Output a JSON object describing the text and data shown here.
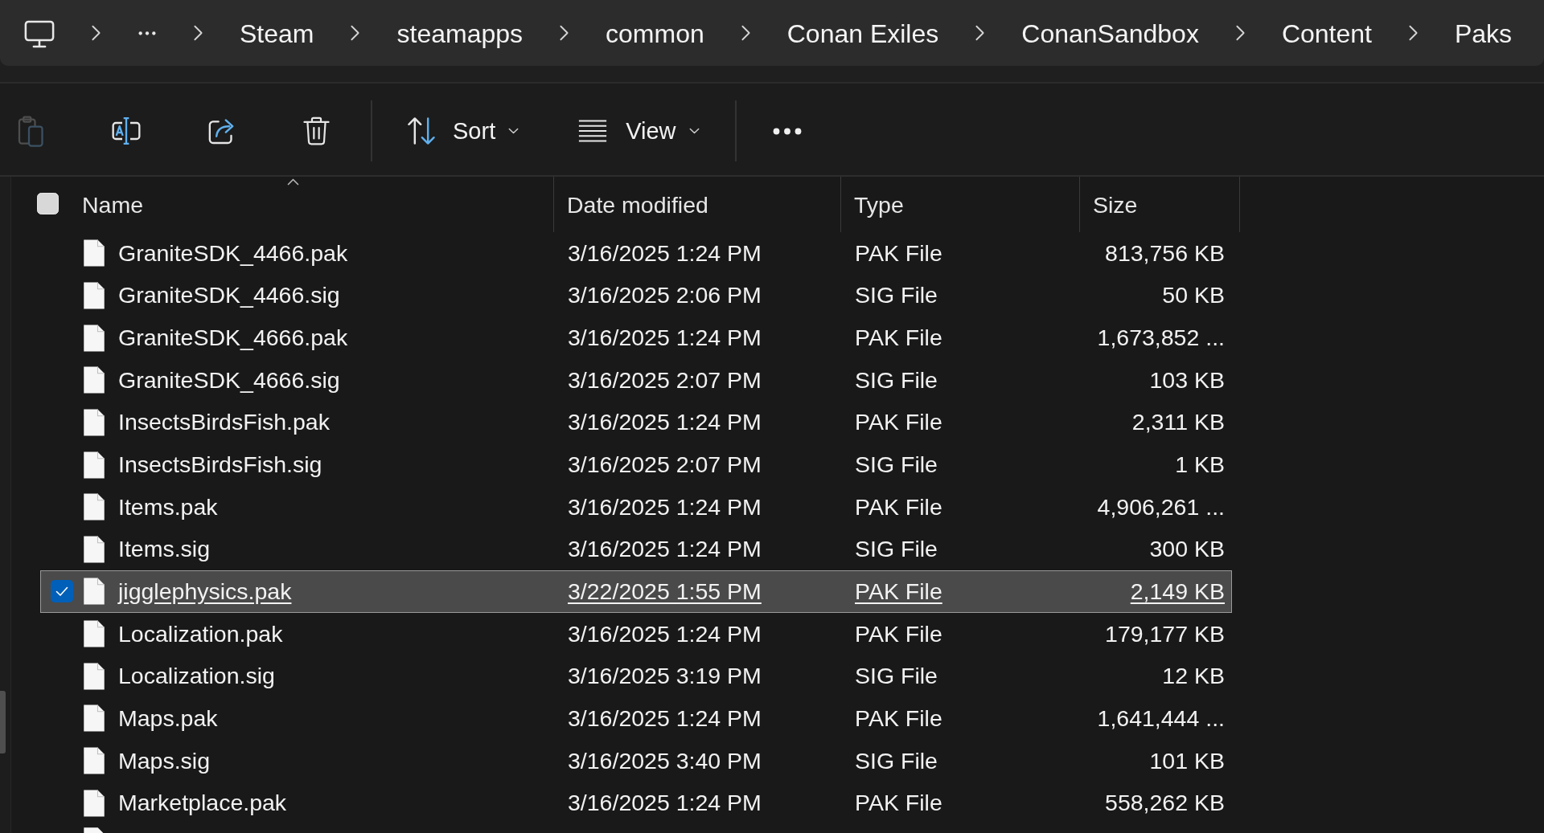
{
  "breadcrumb": {
    "items": [
      "Steam",
      "steamapps",
      "common",
      "Conan Exiles",
      "ConanSandbox",
      "Content",
      "Paks"
    ]
  },
  "toolbar": {
    "buttons": [
      {
        "kind": "paste",
        "disabled": true
      },
      {
        "kind": "rename",
        "disabled": false
      },
      {
        "kind": "share",
        "disabled": false
      },
      {
        "kind": "delete",
        "disabled": false
      }
    ],
    "menus": [
      {
        "kind": "sort",
        "label": "Sort"
      },
      {
        "kind": "view",
        "label": "View"
      }
    ]
  },
  "table": {
    "select_all": {
      "checked": false
    },
    "columns": [
      {
        "label": "Name",
        "sorted": true
      },
      {
        "label": "Date modified",
        "sorted": false
      },
      {
        "label": "Type",
        "sorted": false
      },
      {
        "label": "Size",
        "sorted": false
      }
    ],
    "rows": [
      {
        "name": "GraniteSDK_4466.pak",
        "date": "3/16/2025 1:24 PM",
        "type": "PAK File",
        "size": "813,756 KB",
        "selected": false
      },
      {
        "name": "GraniteSDK_4466.sig",
        "date": "3/16/2025 2:06 PM",
        "type": "SIG File",
        "size": "50 KB",
        "selected": false
      },
      {
        "name": "GraniteSDK_4666.pak",
        "date": "3/16/2025 1:24 PM",
        "type": "PAK File",
        "size": "1,673,852 ...",
        "selected": false
      },
      {
        "name": "GraniteSDK_4666.sig",
        "date": "3/16/2025 2:07 PM",
        "type": "SIG File",
        "size": "103 KB",
        "selected": false
      },
      {
        "name": "InsectsBirdsFish.pak",
        "date": "3/16/2025 1:24 PM",
        "type": "PAK File",
        "size": "2,311 KB",
        "selected": false
      },
      {
        "name": "InsectsBirdsFish.sig",
        "date": "3/16/2025 2:07 PM",
        "type": "SIG File",
        "size": "1 KB",
        "selected": false
      },
      {
        "name": "Items.pak",
        "date": "3/16/2025 1:24 PM",
        "type": "PAK File",
        "size": "4,906,261 ...",
        "selected": false
      },
      {
        "name": "Items.sig",
        "date": "3/16/2025 1:24 PM",
        "type": "SIG File",
        "size": "300 KB",
        "selected": false
      },
      {
        "name": "jigglephysics.pak",
        "date": "3/22/2025 1:55 PM",
        "type": "PAK File",
        "size": "2,149 KB",
        "selected": true
      },
      {
        "name": "Localization.pak",
        "date": "3/16/2025 1:24 PM",
        "type": "PAK File",
        "size": "179,177 KB",
        "selected": false
      },
      {
        "name": "Localization.sig",
        "date": "3/16/2025 3:19 PM",
        "type": "SIG File",
        "size": "12 KB",
        "selected": false
      },
      {
        "name": "Maps.pak",
        "date": "3/16/2025 1:24 PM",
        "type": "PAK File",
        "size": "1,641,444 ...",
        "selected": false
      },
      {
        "name": "Maps.sig",
        "date": "3/16/2025 3:40 PM",
        "type": "SIG File",
        "size": "101 KB",
        "selected": false
      },
      {
        "name": "Marketplace.pak",
        "date": "3/16/2025 1:24 PM",
        "type": "PAK File",
        "size": "558,262 KB",
        "selected": false
      }
    ]
  }
}
